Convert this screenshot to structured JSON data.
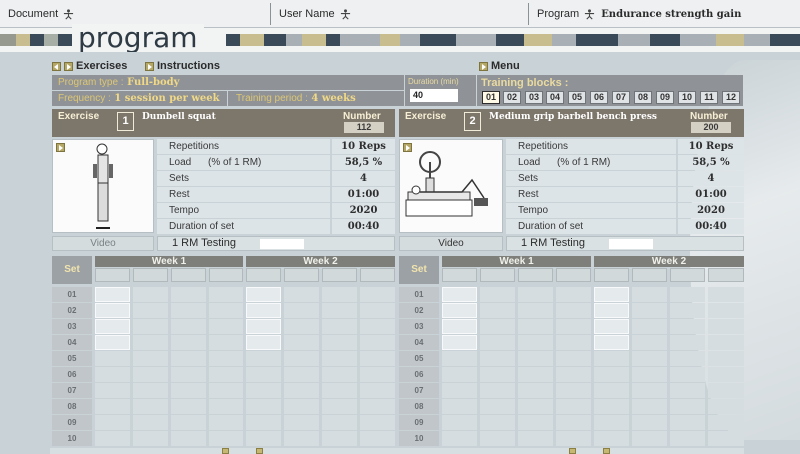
{
  "header": {
    "document_label": "Document",
    "username_label": "User Name",
    "program_label": "Program",
    "program_value": "Endurance strength gain"
  },
  "brand": {
    "word": "program"
  },
  "nav": {
    "exercises_label": "Exercises",
    "instructions_label": "Instructions",
    "menu_label": "Menu"
  },
  "program_info": {
    "type_label": "Program type :",
    "type_value": "Full-body",
    "frequency_label": "Frequency :",
    "frequency_value": "1 session per week",
    "period_label": "Training period :",
    "period_value": "4 weeks",
    "duration_label": "Duration (min)",
    "duration_value": "40",
    "blocks_label": "Training blocks :",
    "blocks": [
      "01",
      "02",
      "03",
      "04",
      "05",
      "06",
      "07",
      "08",
      "09",
      "10",
      "11",
      "12"
    ],
    "active_block": "01"
  },
  "exercise_label": "Exercise",
  "number_label": "Number",
  "params": {
    "repetitions": "Repetitions",
    "load": "Load",
    "load_unit": "(% of 1 RM)",
    "sets": "Sets",
    "rest": "Rest",
    "tempo": "Tempo",
    "duration": "Duration of set"
  },
  "video_label": "Video",
  "rm_label": "1 RM Testing",
  "set_label": "Set",
  "week_labels": [
    "Week 1",
    "Week 2"
  ],
  "set_rows": [
    "01",
    "02",
    "03",
    "04",
    "05",
    "06",
    "07",
    "08",
    "09",
    "10"
  ],
  "exercises": [
    {
      "index": "1",
      "name": "Dumbell squat",
      "number": "112",
      "repetitions": "10 Reps",
      "load": "58,5 %",
      "sets": "4",
      "rest": "01:00",
      "tempo": "2020",
      "duration": "00:40"
    },
    {
      "index": "2",
      "name": "Medium grip barbell bench press",
      "number": "200",
      "repetitions": "10 Reps",
      "load": "58,5 %",
      "sets": "4",
      "rest": "01:00",
      "tempo": "2020",
      "duration": "00:40"
    }
  ]
}
